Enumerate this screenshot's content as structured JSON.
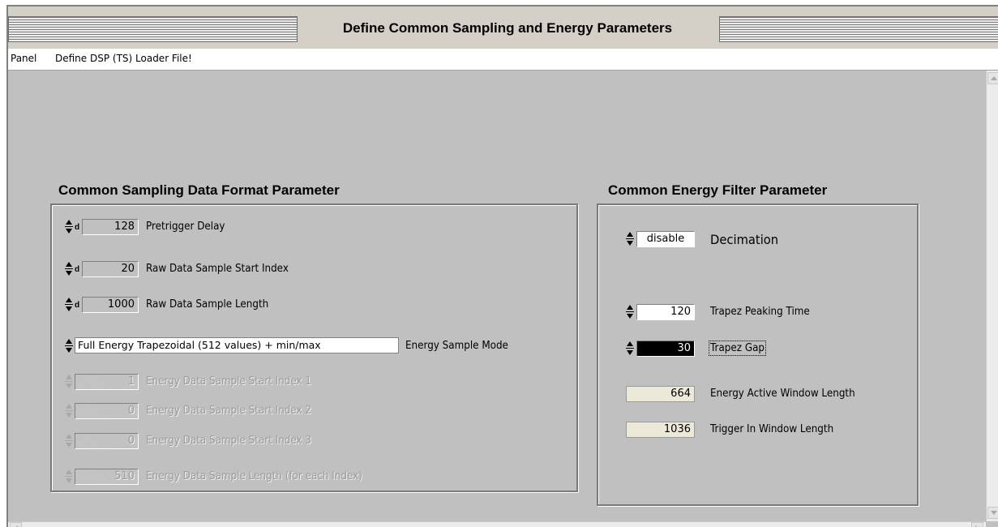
{
  "window": {
    "title": "Define Common Sampling and Energy Parameters"
  },
  "menu": {
    "items": [
      "Panel",
      "Define DSP (TS) Loader File!"
    ]
  },
  "sampling": {
    "title": "Common Sampling Data Format Parameter",
    "radix": "d",
    "pretrigger_delay": {
      "value": "128",
      "label": "Pretrigger Delay"
    },
    "raw_start_index": {
      "value": "20",
      "label": "Raw Data Sample Start Index"
    },
    "raw_length": {
      "value": "1000",
      "label": "Raw Data Sample Length"
    },
    "energy_mode": {
      "value": "Full Energy Trapezoidal (512 values) + min/max",
      "label": "Energy Sample Mode"
    },
    "energy_start_1": {
      "value": "1",
      "label": "Energy Data Sample Start Index 1"
    },
    "energy_start_2": {
      "value": "0",
      "label": "Energy Data Sample Start Index 2"
    },
    "energy_start_3": {
      "value": "0",
      "label": "Energy Data Sample Start Index 3"
    },
    "energy_length": {
      "value": "510",
      "label": "Energy Data Sample Length (for each Index)"
    }
  },
  "energy": {
    "title": "Common Energy Filter Parameter",
    "decimation": {
      "value": "disable",
      "label": "Decimation"
    },
    "peaking_time": {
      "value": "120",
      "label": "Trapez Peaking Time"
    },
    "gap": {
      "value": "30",
      "label": "Trapez Gap"
    },
    "active_window": {
      "value": "664",
      "label": "Energy Active Window Length"
    },
    "trigger_window": {
      "value": "1036",
      "label": "Trigger In Window Length"
    }
  },
  "colors": {
    "panel_bg": "#c0c0c0",
    "indicator_bg": "#ece9d8",
    "focused_field_bg": "#000000"
  }
}
